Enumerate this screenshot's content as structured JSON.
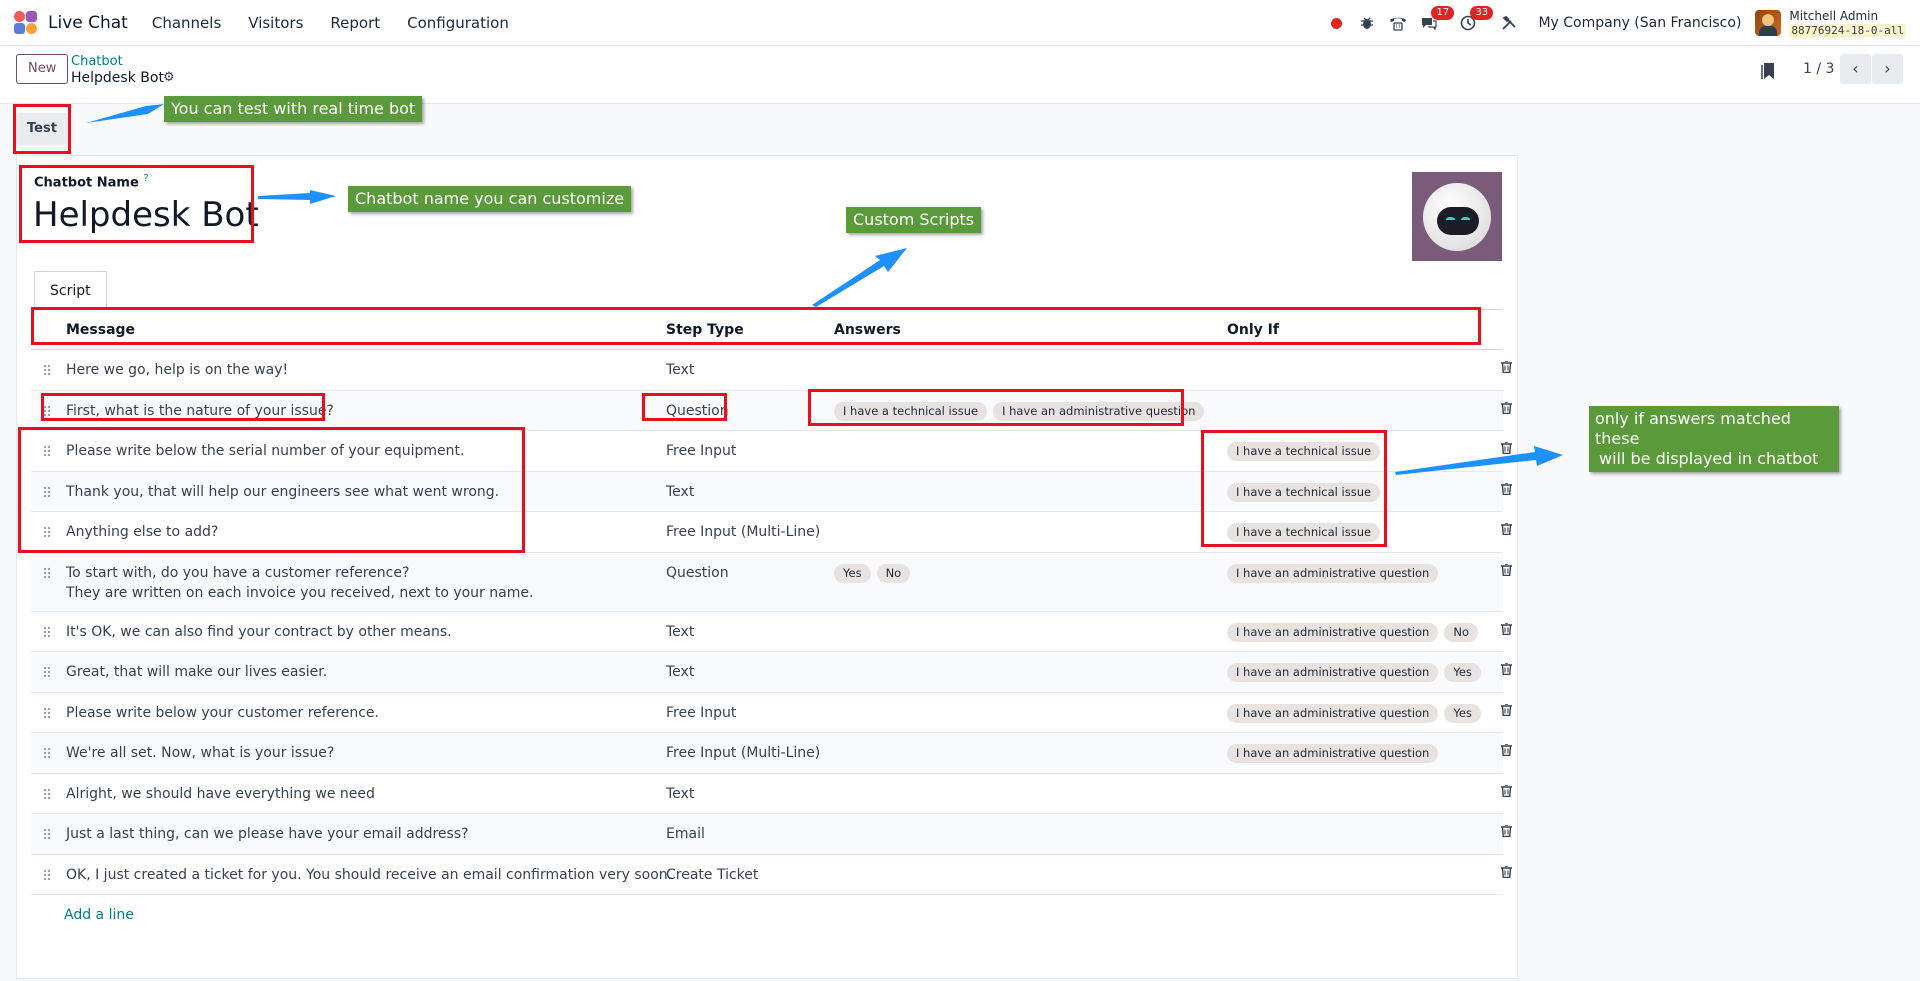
{
  "navbar": {
    "app_name": "Live Chat",
    "menu": [
      "Channels",
      "Visitors",
      "Report",
      "Configuration"
    ],
    "badges": {
      "messages": "17",
      "activities": "33"
    },
    "company": "My Company (San Francisco)",
    "user_name": "Mitchell Admin",
    "db_name": "88776924-18-0-all"
  },
  "control": {
    "new_label": "New",
    "breadcrumb_parent": "Chatbot",
    "breadcrumb_current": "Helpdesk Bot",
    "pager": "1 / 3"
  },
  "test_label": "Test",
  "form": {
    "name_label": "Chatbot Name",
    "name_help": "?",
    "name_value": "Helpdesk Bot",
    "tab_script": "Script",
    "headers": {
      "message": "Message",
      "step_type": "Step Type",
      "answers": "Answers",
      "only_if": "Only If"
    },
    "rows": [
      {
        "message": "Here we go, help is on the way!",
        "step_type": "Text",
        "answers": [],
        "only_if": []
      },
      {
        "message": "First, what is the nature of your issue?",
        "step_type": "Question",
        "answers": [
          "I have a technical issue",
          "I have an administrative question"
        ],
        "only_if": []
      },
      {
        "message": "Please write below the serial number of your equipment.",
        "step_type": "Free Input",
        "answers": [],
        "only_if": [
          "I have a technical issue"
        ]
      },
      {
        "message": "Thank you, that will help our engineers see what went wrong.",
        "step_type": "Text",
        "answers": [],
        "only_if": [
          "I have a technical issue"
        ]
      },
      {
        "message": "Anything else to add?",
        "step_type": "Free Input (Multi-Line)",
        "answers": [],
        "only_if": [
          "I have a technical issue"
        ]
      },
      {
        "message": "To start with, do you have a customer reference?",
        "message2": "They are written on each invoice you received, next to your name.",
        "step_type": "Question",
        "answers": [
          "Yes",
          "No"
        ],
        "only_if": [
          "I have an administrative question"
        ]
      },
      {
        "message": "It's OK, we can also find your contract by other means.",
        "step_type": "Text",
        "answers": [],
        "only_if": [
          "I have an administrative question",
          "No"
        ]
      },
      {
        "message": "Great, that will make our lives easier.",
        "step_type": "Text",
        "answers": [],
        "only_if": [
          "I have an administrative question",
          "Yes"
        ]
      },
      {
        "message": "Please write below your customer reference.",
        "step_type": "Free Input",
        "answers": [],
        "only_if": [
          "I have an administrative question",
          "Yes"
        ]
      },
      {
        "message": "We're all set. Now, what is your issue?",
        "step_type": "Free Input (Multi-Line)",
        "answers": [],
        "only_if": [
          "I have an administrative question"
        ]
      },
      {
        "message": "Alright, we should have everything we need",
        "step_type": "Text",
        "answers": [],
        "only_if": []
      },
      {
        "message": "Just a last thing, can we please have your email address?",
        "step_type": "Email",
        "answers": [],
        "only_if": []
      },
      {
        "message": "OK, I just created a ticket for you. You should receive an email confirmation very soon.",
        "step_type": "Create Ticket",
        "answers": [],
        "only_if": []
      }
    ],
    "add_line": "Add a line"
  },
  "annotations": {
    "test_note": "You can test with real time bot",
    "name_note": "Chatbot name you can customize",
    "scripts_note": "Custom Scripts",
    "only_if_note_1": "only if answers matched these",
    "only_if_note_2": "will be displayed in chatbot"
  },
  "colors": {
    "brand": "#714b67",
    "link": "#017e84",
    "annotation_red": "#e8101e",
    "callout_green": "#5a9a3a",
    "arrow_blue": "#1e90ff"
  }
}
